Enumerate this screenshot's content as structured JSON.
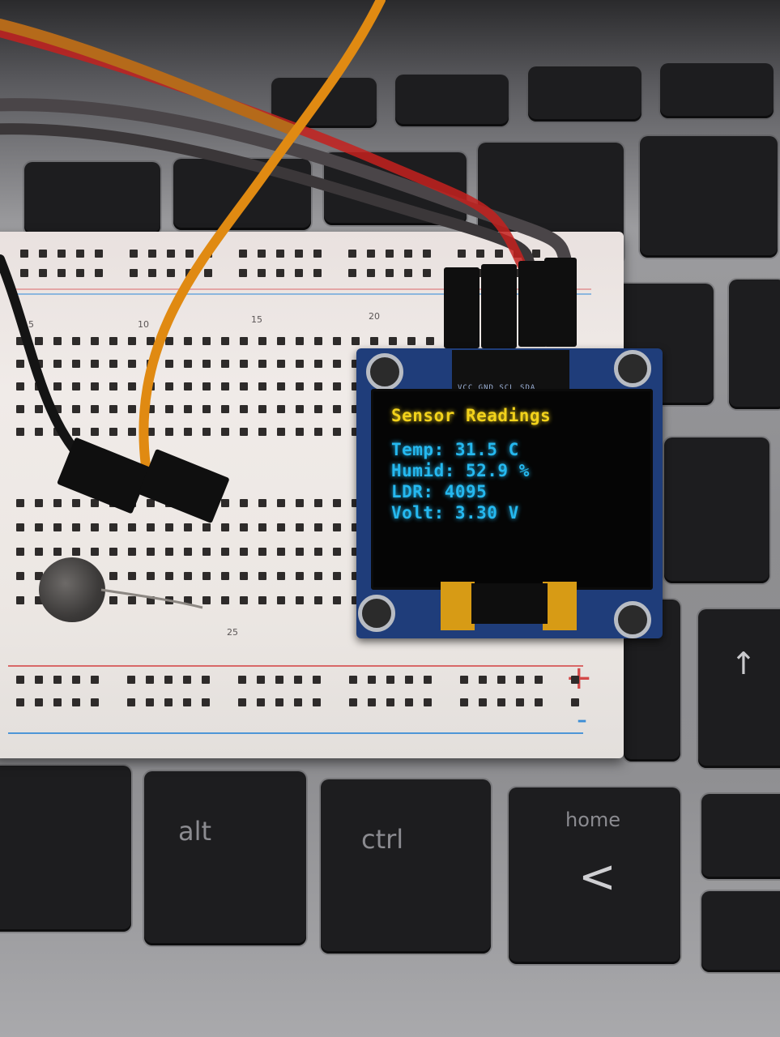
{
  "oled": {
    "title": "Sensor Readings",
    "lines": [
      "Temp: 31.5 C",
      "Humid: 52.9 %",
      "LDR: 4095",
      "Volt: 3.30 V"
    ],
    "pin_label": "VCC GND SCL SDA",
    "title_color": "#f2d21b",
    "text_color": "#25b8ef"
  },
  "breadboard": {
    "rail_plus": "+",
    "rail_minus": "-",
    "column_numbers": [
      "5",
      "10",
      "15",
      "20",
      "25"
    ]
  },
  "keyboard": {
    "keys": {
      "alt": "alt",
      "ctrl": "ctrl",
      "home": "home",
      "home_arrow": "<",
      "up_arrow": "↑"
    }
  },
  "colors": {
    "wire_orange": "#e08a12",
    "wire_red": "#c4211e",
    "wire_gray": "#4a4548",
    "rail_red": "#d34848",
    "rail_blue": "#3c8ed6"
  }
}
